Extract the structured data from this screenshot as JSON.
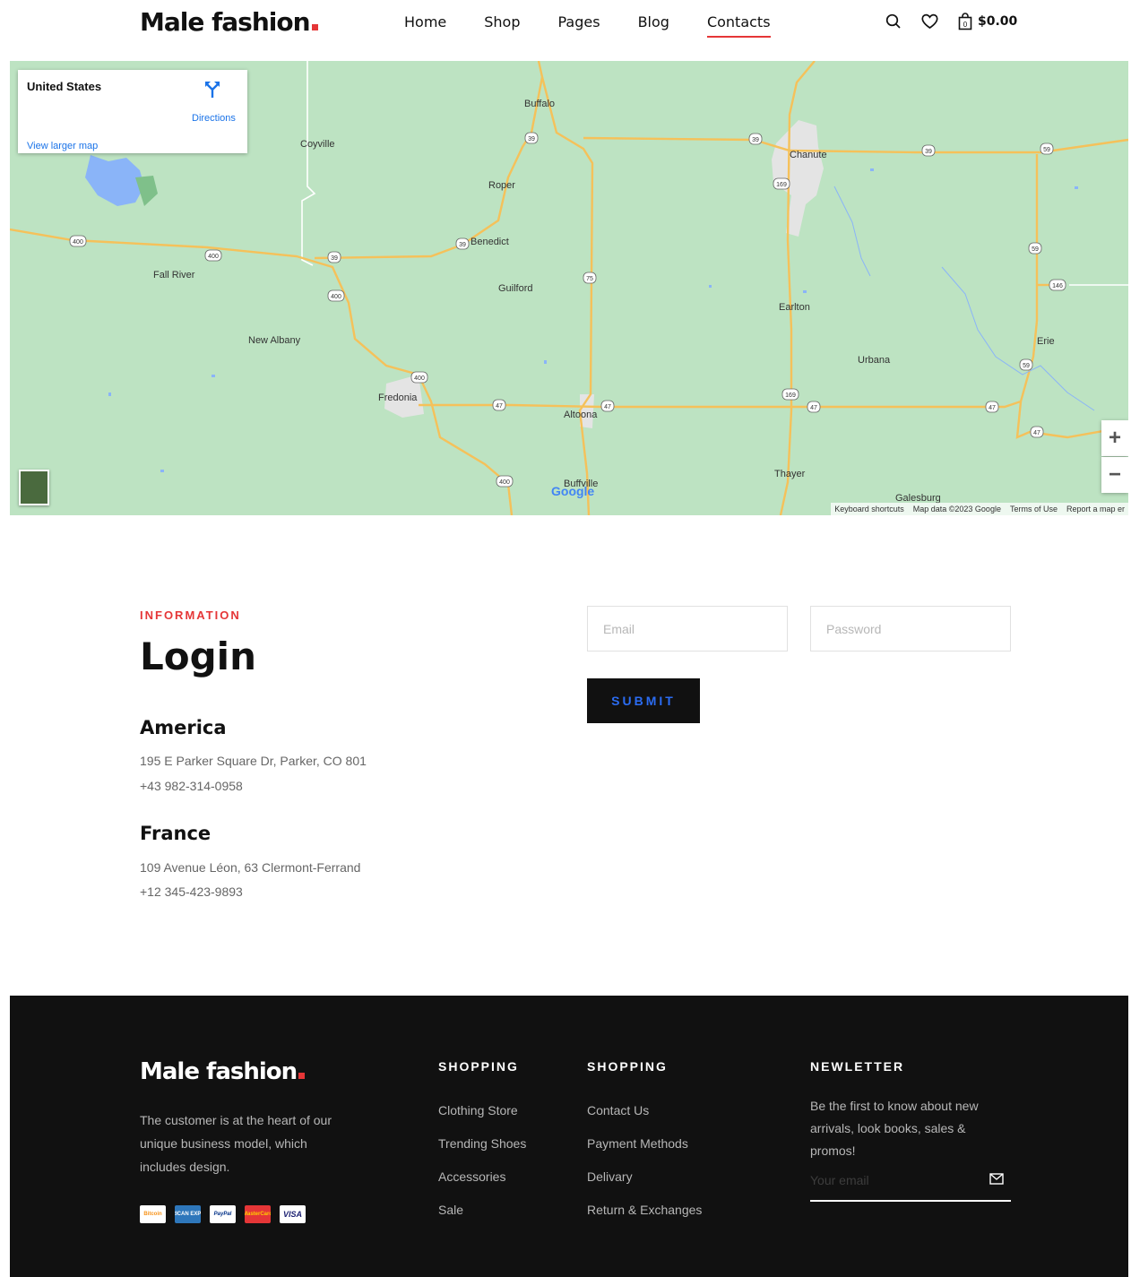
{
  "header": {
    "logo": "Male fashion",
    "nav": [
      "Home",
      "Shop",
      "Pages",
      "Blog",
      "Contacts"
    ],
    "active_nav": "Contacts",
    "cart_count": "0",
    "cart_price": "$0.00",
    "icons": [
      "search-icon",
      "heart-icon",
      "shopping-bag-icon"
    ]
  },
  "map": {
    "card_title": "United States",
    "directions": "Directions",
    "view_larger": "View larger map",
    "places": [
      "Buffalo",
      "Coyville",
      "Roper",
      "Chanute",
      "Benedict",
      "Fall River",
      "Guilford",
      "Earlton",
      "New Albany",
      "Urbana",
      "Erie",
      "Fredonia",
      "Altoona",
      "Thayer",
      "Buffville",
      "Galesburg"
    ],
    "route_shields": [
      "39",
      "39",
      "39",
      "39",
      "39",
      "59",
      "59",
      "59",
      "146",
      "169",
      "169",
      "400",
      "400",
      "400",
      "400",
      "400",
      "75",
      "47",
      "47",
      "47",
      "47",
      "47"
    ],
    "zoom_in": "+",
    "zoom_out": "−",
    "google": "Google",
    "footer": [
      "Keyboard shortcuts",
      "Map data ©2023 Google",
      "Terms of Use",
      "Report a map er"
    ],
    "colors": {
      "land": "#bde3c2",
      "road": "#f5c15a",
      "water": "#8ab4f8"
    }
  },
  "contact": {
    "label": "INFORMATION",
    "title": "Login",
    "regions": [
      {
        "name": "America",
        "address": "195 E Parker Square Dr, Parker, CO 801",
        "phone": "+43 982-314-0958"
      },
      {
        "name": "France",
        "address": "109 Avenue Léon, 63 Clermont-Ferrand",
        "phone": "+12 345-423-9893"
      }
    ],
    "email_placeholder": "Email",
    "password_placeholder": "Password",
    "submit": "SUBMIT"
  },
  "footer": {
    "logo": "Male fashion",
    "description": "The customer is at the heart of our unique business model, which includes design.",
    "payments": [
      "Bitcoin",
      "AMERICAN EXPRESS",
      "PayPal",
      "MasterCard",
      "VISA"
    ],
    "col1": {
      "title": "SHOPPING",
      "items": [
        "Clothing Store",
        "Trending Shoes",
        "Accessories",
        "Sale"
      ]
    },
    "col2": {
      "title": "SHOPPING",
      "items": [
        "Contact Us",
        "Payment Methods",
        "Delivary",
        "Return & Exchanges"
      ]
    },
    "newsletter": {
      "title": "NEWLETTER",
      "text": "Be the first to know about new arrivals, look books, sales & promos!",
      "placeholder": "Your email"
    },
    "colors": {
      "background": "#111111",
      "accent": "#e53637"
    }
  }
}
